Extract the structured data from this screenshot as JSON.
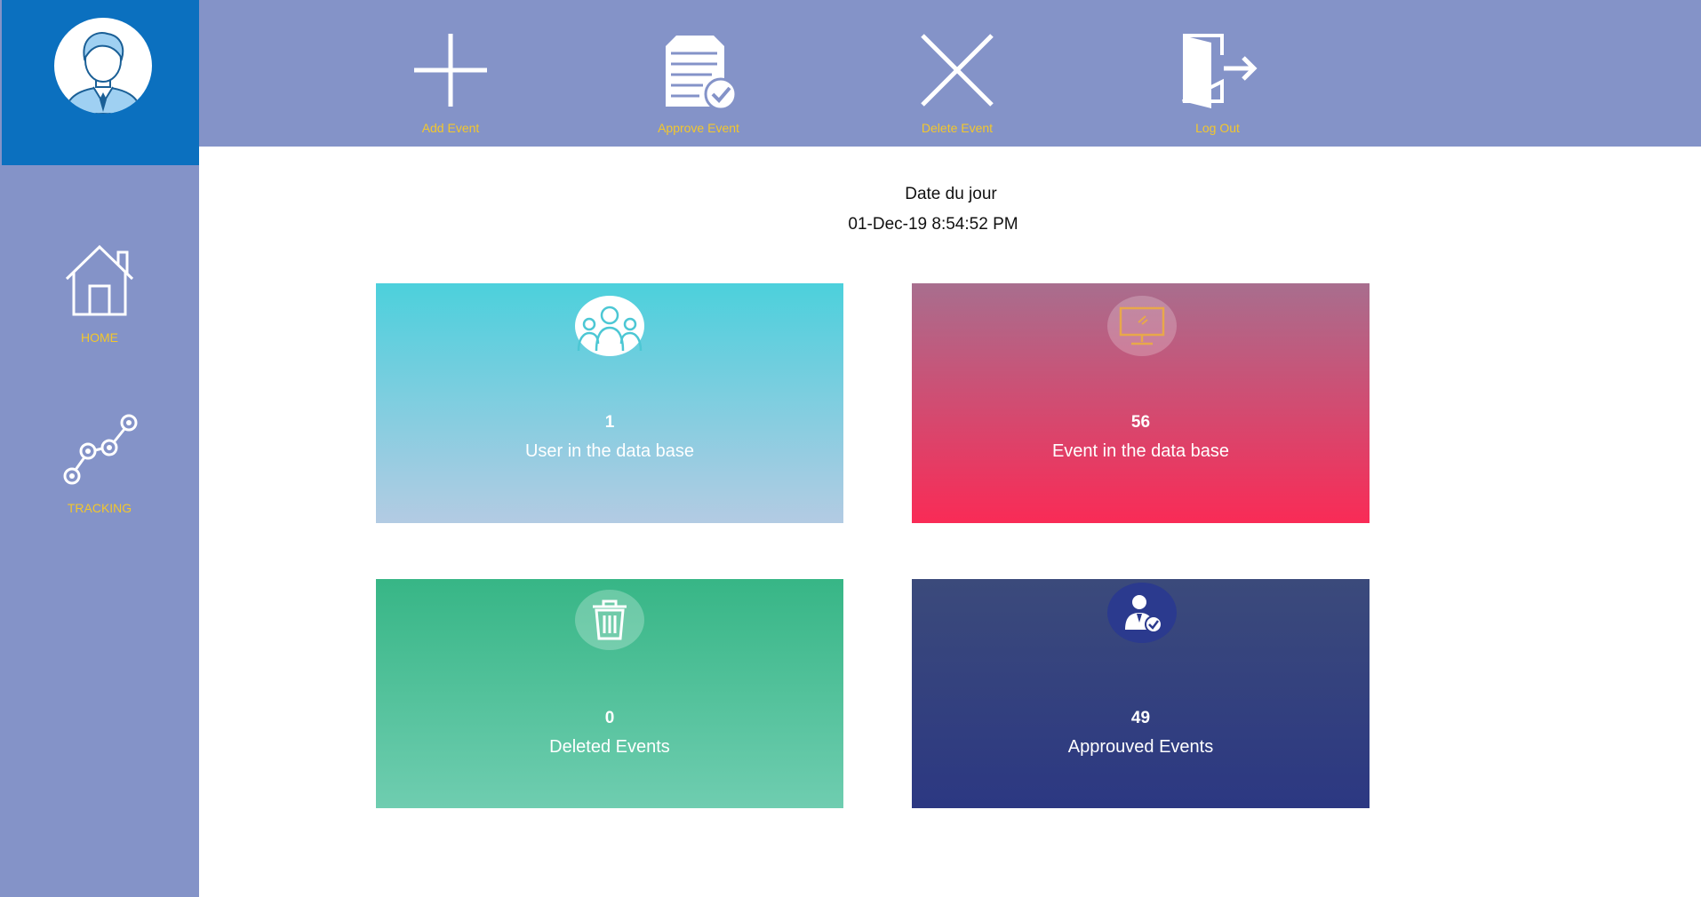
{
  "sidebar": {
    "avatar_icon": "user-avatar-icon",
    "items": [
      {
        "label": "HOME",
        "icon": "home-icon"
      },
      {
        "label": "TRACKING",
        "icon": "tracking-icon"
      }
    ]
  },
  "toolbar": {
    "items": [
      {
        "label": "Add Event",
        "icon": "plus-icon"
      },
      {
        "label": "Approve Event",
        "icon": "document-check-icon"
      },
      {
        "label": "Delete Event",
        "icon": "x-icon"
      },
      {
        "label": "Log Out",
        "icon": "logout-icon"
      }
    ]
  },
  "date": {
    "title": "Date du jour",
    "value": "01-Dec-19 8:54:52 PM"
  },
  "cards": [
    {
      "count": "1",
      "label": "User in the data base",
      "icon": "users-icon"
    },
    {
      "count": "56",
      "label": "Event in the data base",
      "icon": "monitor-icon"
    },
    {
      "count": "0",
      "label": "Deleted Events",
      "icon": "trash-icon"
    },
    {
      "count": "49",
      "label": "Approuved Events",
      "icon": "approved-user-icon"
    }
  ],
  "colors": {
    "sidebar": "#8493c8",
    "avatar_bg": "#0b70bf",
    "label_yellow": "#f3c72c"
  }
}
